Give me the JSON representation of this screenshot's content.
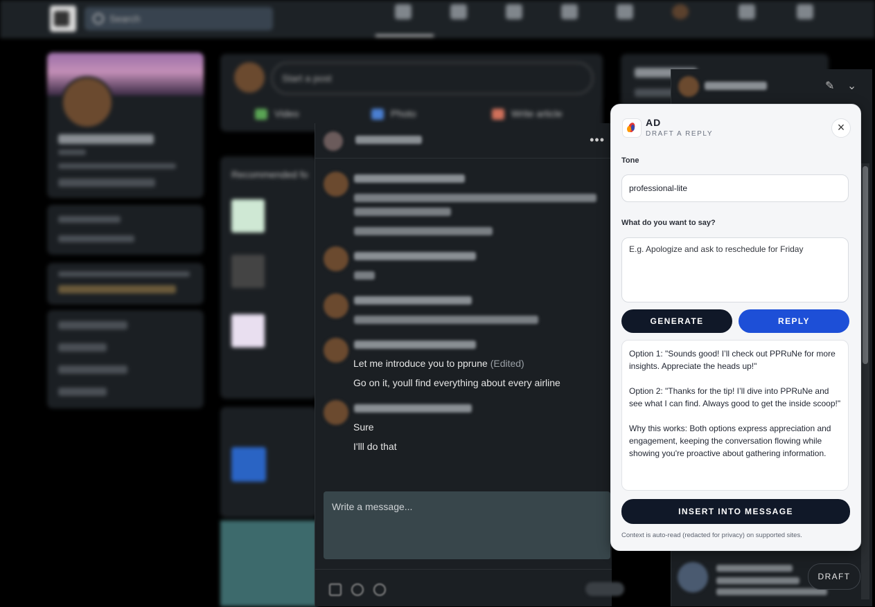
{
  "linkedin": {
    "search_placeholder": "Search",
    "start_post": "Start a post",
    "actions": {
      "video": "Video",
      "photo": "Photo",
      "write_article": "Write article"
    },
    "recommended": "Recommended fo"
  },
  "chat": {
    "messages": {
      "m1": "Let me introduce you to pprune",
      "m1_edited": "(Edited)",
      "m2": "Go on it, youll find everything about every airline",
      "m3": "Sure",
      "m4": "I'lll do that"
    },
    "composer_placeholder": "Write a message..."
  },
  "ad_panel": {
    "title": "AD",
    "subtitle": "DRAFT A REPLY",
    "close": "×",
    "tone_label": "Tone",
    "tone_value": "professional-lite",
    "say_label": "What do you want to say?",
    "say_placeholder": "E.g. Apologize and ask to reschedule for Friday",
    "generate": "GENERATE",
    "reply": "REPLY",
    "output": {
      "option1": "Option 1: \"Sounds good! I’ll check out PPRuNe for more insights. Appreciate the heads up!\"",
      "option2": "Option 2: \"Thanks for the tip! I’ll dive into PPRuNe and see what I can find. Always good to get the inside scoop!\"",
      "why": "Why this works: Both options express appreciation and engagement, keeping the conversation flowing while showing you're proactive about gathering information."
    },
    "insert": "INSERT INTO MESSAGE",
    "note": "Context is auto-read (redacted for privacy) on supported sites.",
    "colors": {
      "dark_button": "#101828",
      "reply_button": "#1d4fd7"
    }
  },
  "draft_button": "DRAFT",
  "icons": [
    "close-icon",
    "more-icon",
    "search-icon",
    "edit-icon",
    "chevron-down-icon"
  ]
}
